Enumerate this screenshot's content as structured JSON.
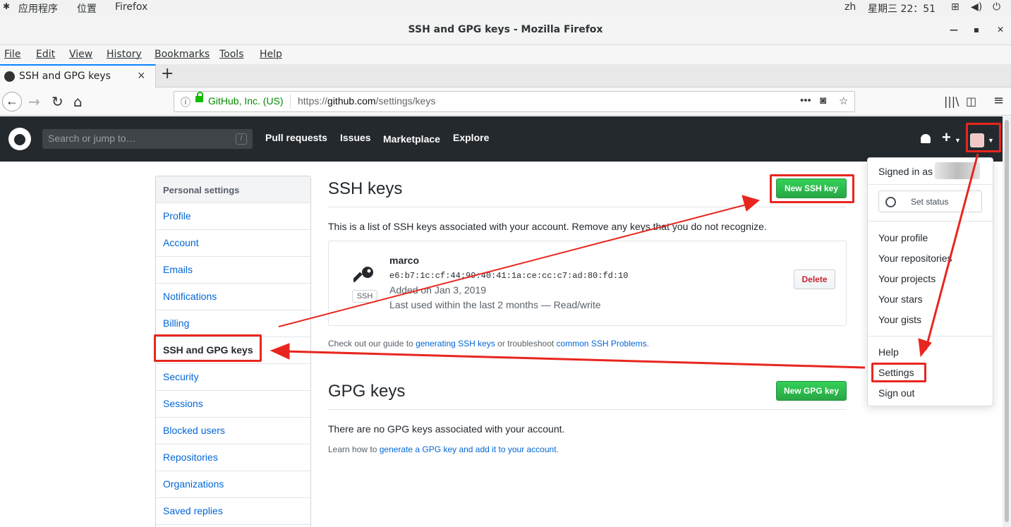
{
  "system_bar": {
    "apps": "应用程序",
    "places": "位置",
    "app": "Firefox",
    "lang": "zh",
    "clock": "星期三 22：51"
  },
  "window": {
    "title": "SSH and GPG keys - Mozilla Firefox"
  },
  "menu": {
    "file": "File",
    "edit": "Edit",
    "view": "View",
    "history": "History",
    "bookmarks": "Bookmarks",
    "tools": "Tools",
    "help": "Help"
  },
  "tab": {
    "title": "SSH and GPG keys"
  },
  "urlbar": {
    "org": "GitHub, Inc. (US)",
    "url_prefix": "https://",
    "url_domain": "github.com",
    "url_path": "/settings/keys"
  },
  "github": {
    "search_placeholder": "Search or jump to…",
    "search_key": "/",
    "nav": [
      "Pull requests",
      "Issues",
      "Marketplace",
      "Explore"
    ]
  },
  "sidebar": {
    "header": "Personal settings",
    "items": [
      "Profile",
      "Account",
      "Emails",
      "Notifications",
      "Billing",
      "SSH and GPG keys",
      "Security",
      "Sessions",
      "Blocked users",
      "Repositories",
      "Organizations",
      "Saved replies"
    ]
  },
  "ssh": {
    "title": "SSH keys",
    "new_button": "New SSH key",
    "intro": "This is a list of SSH keys associated with your account. Remove any keys that you do not recognize.",
    "key": {
      "name": "marco",
      "fingerprint": "e6:b7:1c:cf:44:99:40:41:1a:ce:cc:c7:ad:80:fd:10",
      "added": "Added on Jan 3, 2019",
      "last_used": "Last used within the last 2 months — Read/write",
      "badge": "SSH",
      "delete": "Delete"
    },
    "guide_pre": "Check out our guide to ",
    "guide_link1": "generating SSH keys",
    "guide_mid": " or troubleshoot ",
    "guide_link2": "common SSH Problems",
    "guide_post": "."
  },
  "gpg": {
    "title": "GPG keys",
    "new_button": "New GPG key",
    "empty": "There are no GPG keys associated with your account.",
    "learn_pre": "Learn how to ",
    "learn_link": "generate a GPG key and add it to your account",
    "learn_post": "."
  },
  "dropdown": {
    "signed_in": "Signed in as",
    "set_status": "Set status",
    "items": [
      "Your profile",
      "Your repositories",
      "Your projects",
      "Your stars",
      "Your gists"
    ],
    "help": "Help",
    "settings": "Settings",
    "sign_out": "Sign out"
  },
  "colors": {
    "annotation": "#e8261f",
    "github_header": "#24292e",
    "link": "#0366d6",
    "green": "#28a745"
  }
}
